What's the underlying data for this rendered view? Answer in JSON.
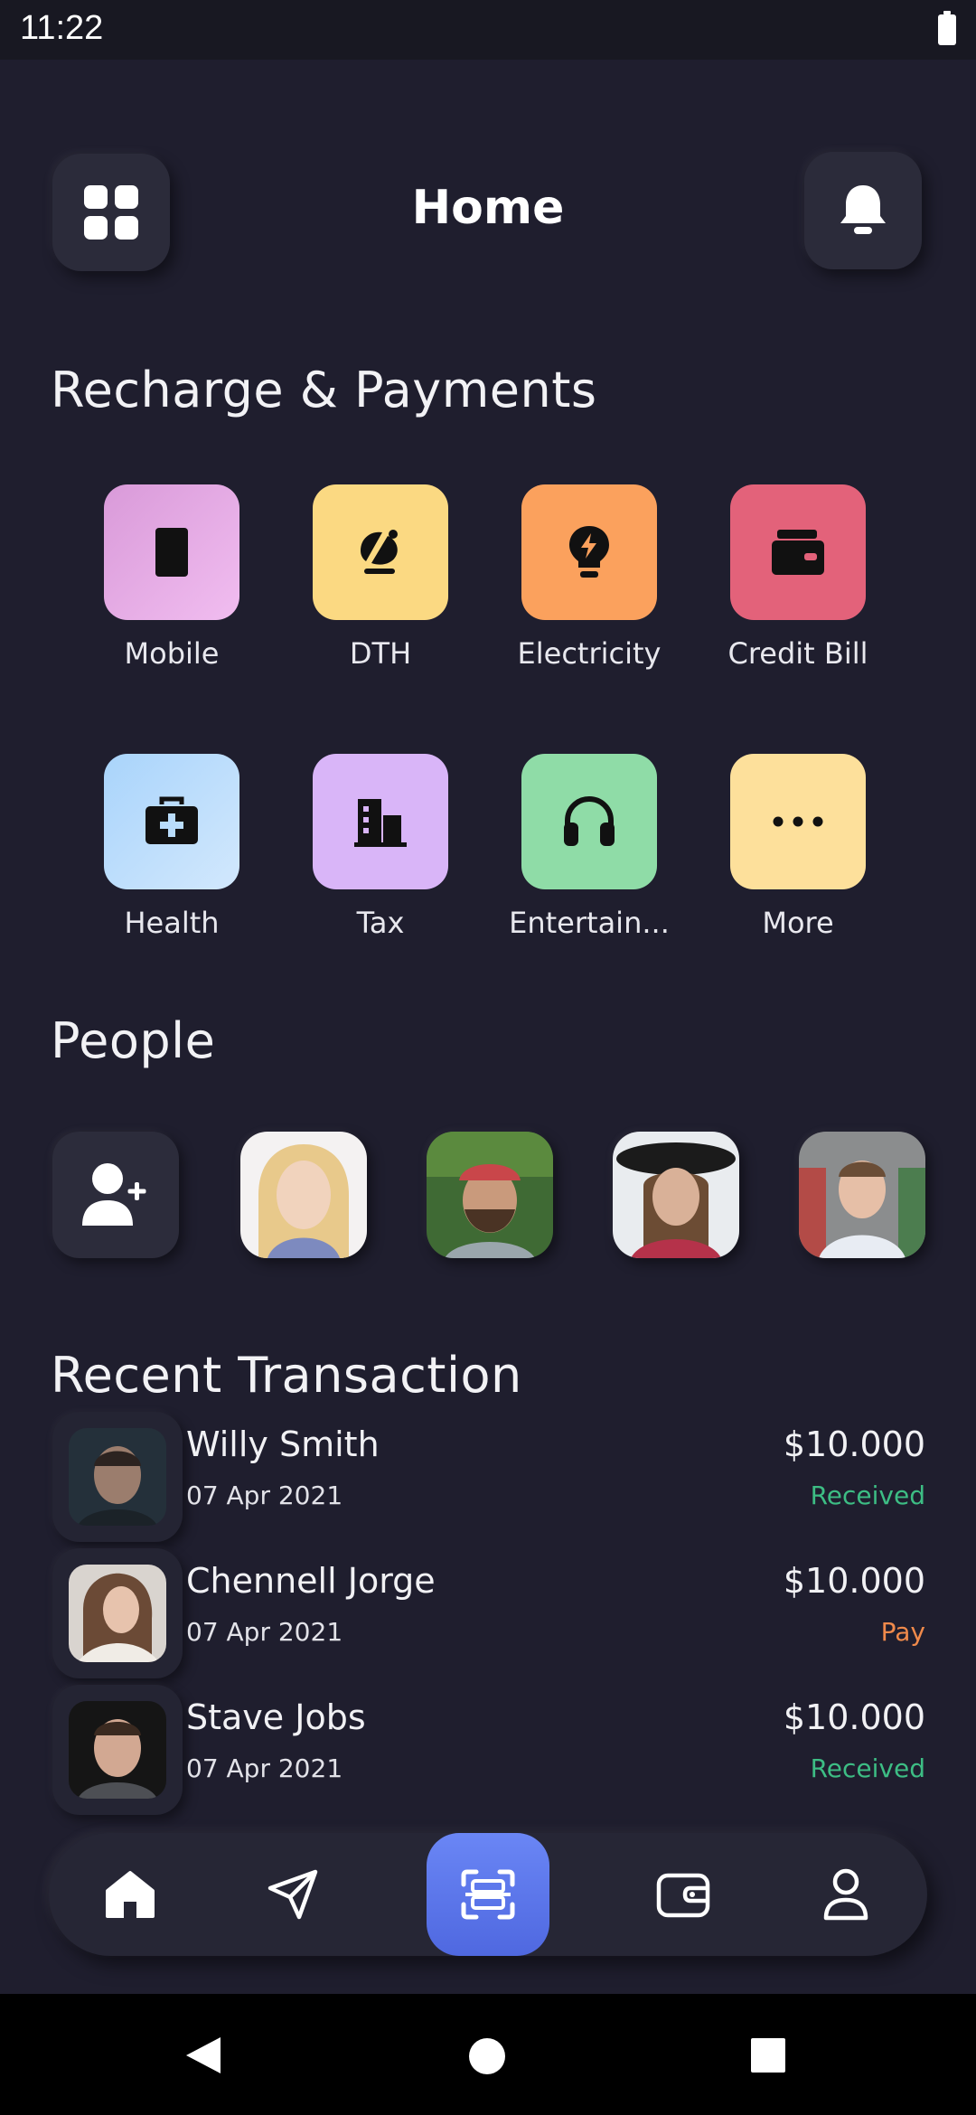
{
  "status_bar": {
    "time": "11:22"
  },
  "header": {
    "title": "Home"
  },
  "recharge": {
    "title": "Recharge & Payments",
    "items": [
      {
        "label": "Mobile",
        "color": "#e7a8e6"
      },
      {
        "label": "DTH",
        "color": "#fbd982"
      },
      {
        "label": "Electricity",
        "color": "#fba15d"
      },
      {
        "label": "Credit Bill",
        "color": "#e3627a"
      },
      {
        "label": "Health",
        "color": "#b9dcfb"
      },
      {
        "label": "Tax",
        "color": "#d9b5f8"
      },
      {
        "label": "Entertain...",
        "color": "#8fdca7"
      },
      {
        "label": "More",
        "color": "#fde09b"
      }
    ]
  },
  "people": {
    "title": "People"
  },
  "transactions": {
    "title": "Recent Transaction",
    "items": [
      {
        "name": "Willy Smith",
        "date": "07 Apr 2021",
        "amount": "$10.000",
        "status": "Received"
      },
      {
        "name": "Chennell Jorge",
        "date": "07 Apr 2021",
        "amount": "$10.000",
        "status": "Pay"
      },
      {
        "name": "Stave Jobs",
        "date": "07 Apr 2021",
        "amount": "$10.000",
        "status": "Received"
      }
    ]
  },
  "colors": {
    "background": "#1f1e2e",
    "received": "#3dbd84",
    "pay": "#f08a4b",
    "accent": "#5b75ea"
  }
}
